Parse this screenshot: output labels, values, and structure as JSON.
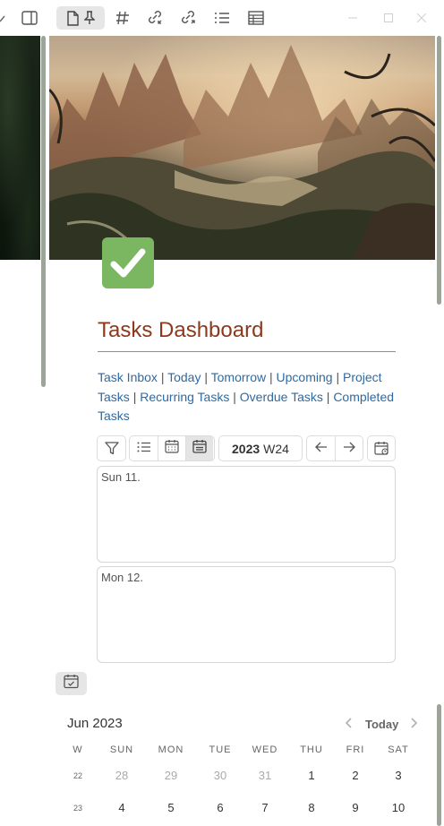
{
  "toolbar": {
    "icons": [
      "chevron-icon",
      "sidebar-toggle-icon",
      "file-icon",
      "pin-icon",
      "tag-icon",
      "backlinks-icon",
      "outgoing-links-icon",
      "outline-icon",
      "table-icon"
    ],
    "window_controls": [
      "minimize",
      "maximize",
      "close"
    ]
  },
  "note": {
    "emoji": "✅",
    "title": "Tasks Dashboard",
    "links": [
      {
        "label": "Task Inbox"
      },
      {
        "label": "Today"
      },
      {
        "label": "Tomorrow"
      },
      {
        "label": "Upcoming"
      },
      {
        "label": "Project Tasks"
      },
      {
        "label": "Recurring Tasks"
      },
      {
        "label": "Overdue Tasks"
      },
      {
        "label": "Completed Tasks"
      }
    ],
    "separator": "|"
  },
  "tasks_toolbar": {
    "year": "2023",
    "week": "W24",
    "view_buttons": [
      "filter-icon",
      "list-icon",
      "calendar-icon",
      "week-calendar-icon"
    ],
    "nav_buttons": [
      "arrow-left-icon",
      "arrow-right-icon",
      "calendar-today-icon"
    ]
  },
  "days": [
    {
      "label": "Sun 11."
    },
    {
      "label": "Mon 12."
    }
  ],
  "calendar": {
    "month_label": "Jun 2023",
    "today_label": "Today",
    "headers": [
      "W",
      "SUN",
      "MON",
      "TUE",
      "WED",
      "THU",
      "FRI",
      "SAT"
    ],
    "weeks": [
      {
        "week": "22",
        "days": [
          "28",
          "29",
          "30",
          "31",
          "1",
          "2",
          "3"
        ],
        "dim": [
          true,
          true,
          true,
          true,
          false,
          false,
          false
        ]
      },
      {
        "week": "23",
        "days": [
          "4",
          "5",
          "6",
          "7",
          "8",
          "9",
          "10"
        ],
        "dim": [
          false,
          false,
          false,
          false,
          false,
          false,
          false
        ]
      }
    ]
  },
  "colors": {
    "title": "#8b3a1e",
    "link": "#2d6aa4",
    "emoji_bg": "#7bb661"
  }
}
